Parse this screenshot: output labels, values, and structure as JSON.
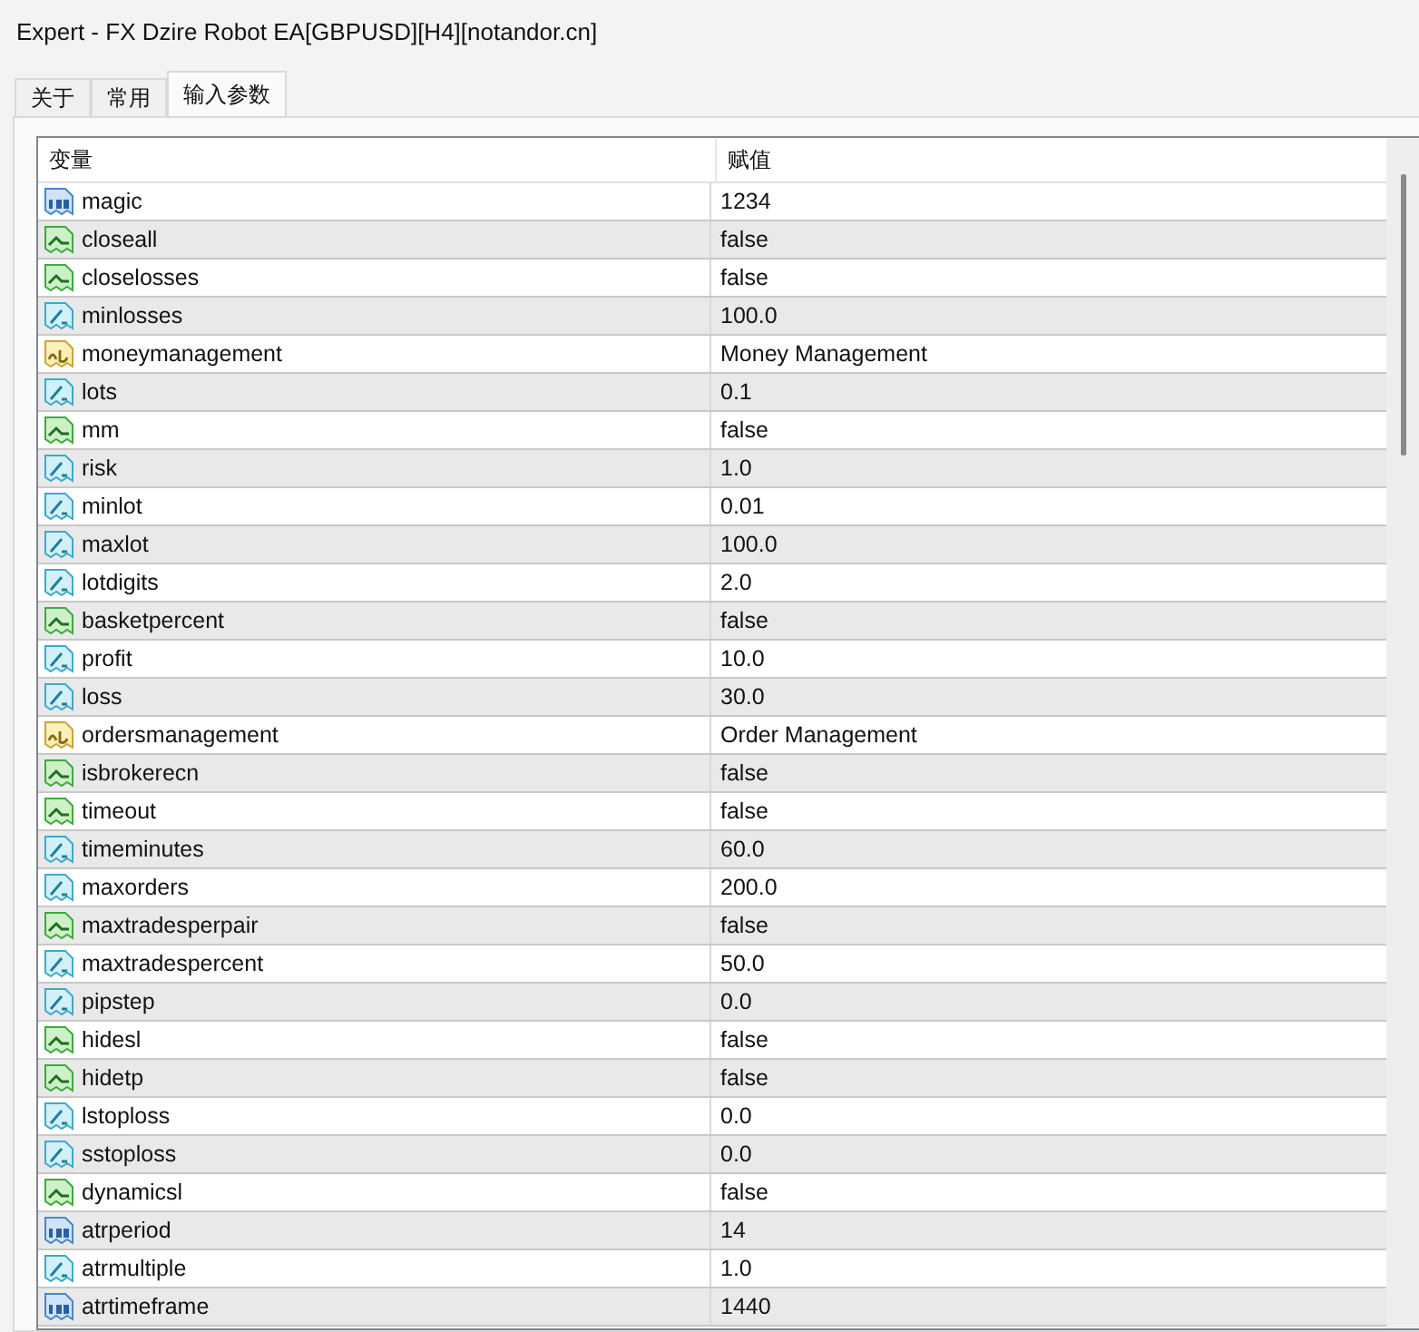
{
  "window": {
    "title": "Expert - FX Dzire Robot EA[GBPUSD][H4][notandor.cn]"
  },
  "tabs": [
    {
      "label": "关于",
      "selected": false
    },
    {
      "label": "常用",
      "selected": false
    },
    {
      "label": "输入参数",
      "selected": true
    }
  ],
  "table": {
    "columns": [
      "变量",
      "赋值"
    ],
    "rows": [
      {
        "kind": "int",
        "name": "magic",
        "value": "1234"
      },
      {
        "kind": "bool",
        "name": "closeall",
        "value": "false"
      },
      {
        "kind": "bool",
        "name": "closelosses",
        "value": "false"
      },
      {
        "kind": "double",
        "name": "minlosses",
        "value": "100.0"
      },
      {
        "kind": "string",
        "name": "moneymanagement",
        "value": "Money Management"
      },
      {
        "kind": "double",
        "name": "lots",
        "value": "0.1"
      },
      {
        "kind": "bool",
        "name": "mm",
        "value": "false"
      },
      {
        "kind": "double",
        "name": "risk",
        "value": "1.0"
      },
      {
        "kind": "double",
        "name": "minlot",
        "value": "0.01"
      },
      {
        "kind": "double",
        "name": "maxlot",
        "value": "100.0"
      },
      {
        "kind": "double",
        "name": "lotdigits",
        "value": "2.0"
      },
      {
        "kind": "bool",
        "name": "basketpercent",
        "value": "false"
      },
      {
        "kind": "double",
        "name": "profit",
        "value": "10.0"
      },
      {
        "kind": "double",
        "name": "loss",
        "value": "30.0"
      },
      {
        "kind": "string",
        "name": "ordersmanagement",
        "value": "Order Management"
      },
      {
        "kind": "bool",
        "name": "isbrokerecn",
        "value": "false"
      },
      {
        "kind": "bool",
        "name": "timeout",
        "value": "false"
      },
      {
        "kind": "double",
        "name": "timeminutes",
        "value": "60.0"
      },
      {
        "kind": "double",
        "name": "maxorders",
        "value": "200.0"
      },
      {
        "kind": "bool",
        "name": "maxtradesperpair",
        "value": "false"
      },
      {
        "kind": "double",
        "name": "maxtradespercent",
        "value": "50.0"
      },
      {
        "kind": "double",
        "name": "pipstep",
        "value": "0.0"
      },
      {
        "kind": "bool",
        "name": "hidesl",
        "value": "false"
      },
      {
        "kind": "bool",
        "name": "hidetp",
        "value": "false"
      },
      {
        "kind": "double",
        "name": "lstoploss",
        "value": "0.0"
      },
      {
        "kind": "double",
        "name": "sstoploss",
        "value": "0.0"
      },
      {
        "kind": "bool",
        "name": "dynamicsl",
        "value": "false"
      },
      {
        "kind": "int",
        "name": "atrperiod",
        "value": "14"
      },
      {
        "kind": "double",
        "name": "atrmultiple",
        "value": "1.0"
      },
      {
        "kind": "int",
        "name": "atrtimeframe",
        "value": "1440"
      }
    ]
  }
}
